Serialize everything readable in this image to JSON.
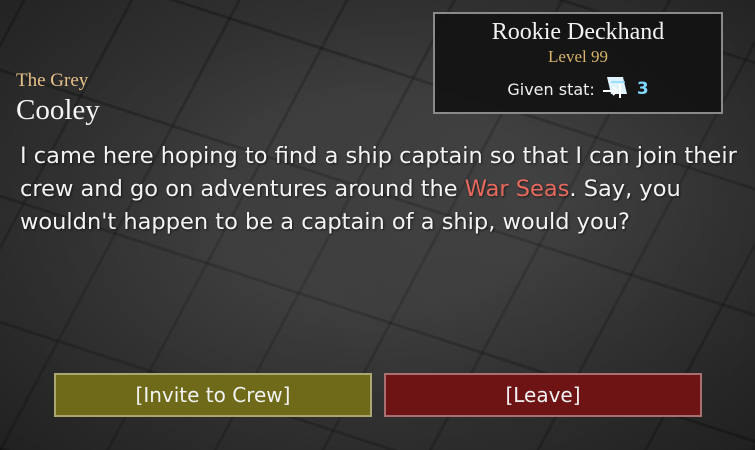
{
  "stat_box": {
    "title": "Rookie Deckhand",
    "level": "Level 99",
    "given_label": "Given stat:",
    "given_icon": "sail-boost-icon",
    "given_value": "3"
  },
  "npc": {
    "title": "The Grey",
    "name": "Cooley"
  },
  "dialogue": {
    "text_before": "I came here hoping to find a ship captain so that I can join their crew and go on adventures around the ",
    "highlight": "War Seas",
    "text_after": ". Say, you wouldn't happen to be a captain of a ship, would you?"
  },
  "buttons": {
    "invite_label": "[Invite to Crew]",
    "leave_label": "[Leave]"
  },
  "colors": {
    "highlight": "#e86a5e",
    "level": "#d7b46a",
    "invite_bg": "#6e6a1a",
    "leave_bg": "#6e1414"
  }
}
